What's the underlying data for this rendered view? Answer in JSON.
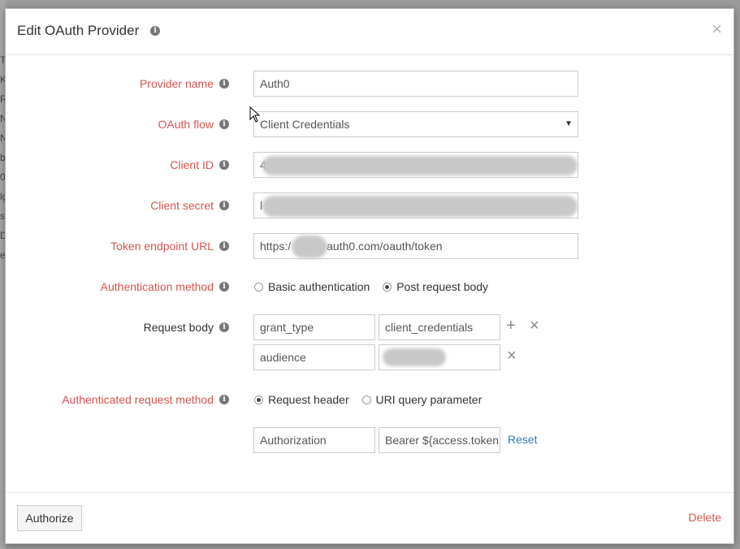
{
  "dialog": {
    "title": "Edit OAuth Provider",
    "close_symbol": "×",
    "info_symbol": "i"
  },
  "form": {
    "provider_name": {
      "label": "Provider name",
      "value": "Auth0"
    },
    "oauth_flow": {
      "label": "OAuth flow",
      "value": "Client Credentials"
    },
    "client_id": {
      "label": "Client ID",
      "value_prefix": "4"
    },
    "client_secret": {
      "label": "Client secret",
      "value_prefix": "l"
    },
    "token_endpoint": {
      "label": "Token endpoint URL",
      "value_prefix": "https:/",
      "value_suffix": "auth0.com/oauth/token"
    },
    "auth_method": {
      "label": "Authentication method",
      "options": [
        "Basic authentication",
        "Post request body"
      ],
      "selected": "Post request body"
    },
    "request_body": {
      "label": "Request body",
      "rows": [
        {
          "key": "grant_type",
          "value": "client_credentials"
        },
        {
          "key": "audience",
          "value": ""
        }
      ],
      "add_symbol": "+",
      "remove_symbol": "×"
    },
    "authenticated_request_method": {
      "label": "Authenticated request method",
      "options": [
        "Request header",
        "URI query parameter"
      ],
      "selected": "Request header"
    },
    "header": {
      "name": "Authorization",
      "value": "Bearer ${access.token",
      "reset_label": "Reset"
    }
  },
  "footer": {
    "authorize_label": "Authorize",
    "delete_label": "Delete"
  },
  "colors": {
    "label_required": "#d9534f",
    "link": "#337ab7",
    "overlay": "#9a9a9a"
  }
}
